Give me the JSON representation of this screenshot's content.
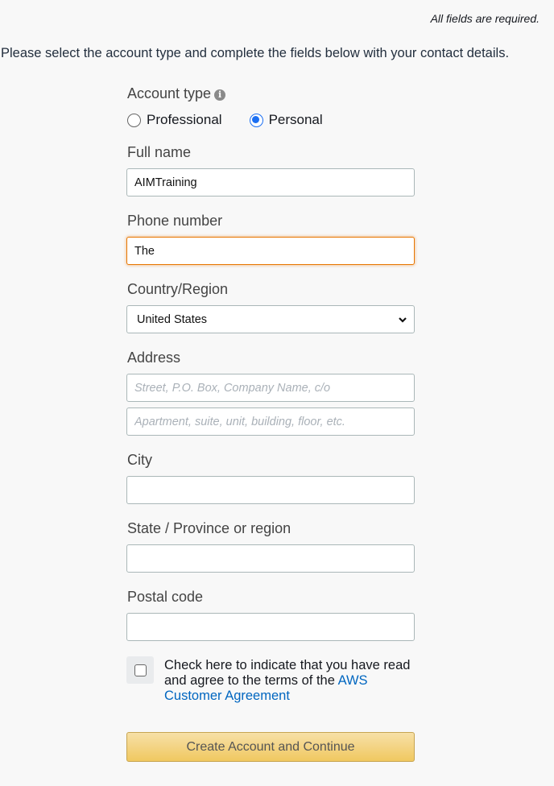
{
  "header": {
    "required_note": "All fields are required.",
    "intro": "Please select the account type and complete the fields below with your contact details."
  },
  "account_type": {
    "label": "Account type",
    "info_icon": "info-icon",
    "options": [
      {
        "label": "Professional",
        "checked": false
      },
      {
        "label": "Personal",
        "checked": true
      }
    ]
  },
  "full_name": {
    "label": "Full name",
    "value": "AIMTraining"
  },
  "phone": {
    "label": "Phone number",
    "value": "The "
  },
  "country": {
    "label": "Country/Region",
    "selected": "United States"
  },
  "address": {
    "label": "Address",
    "line1_placeholder": "Street, P.O. Box, Company Name, c/o",
    "line2_placeholder": "Apartment, suite, unit, building, floor, etc.",
    "line1_value": "",
    "line2_value": ""
  },
  "city": {
    "label": "City",
    "value": ""
  },
  "state": {
    "label": "State / Province or region",
    "value": ""
  },
  "postal": {
    "label": "Postal code",
    "value": ""
  },
  "agreement": {
    "text": "Check here to indicate that you have read and agree to the terms of the ",
    "link": "AWS Customer Agreement",
    "checked": false
  },
  "submit": {
    "label": "Create Account and Continue"
  },
  "colors": {
    "accent": "#e77600",
    "link": "#0066c0",
    "radio": "#1b6ff2",
    "button": "#f0c860"
  }
}
